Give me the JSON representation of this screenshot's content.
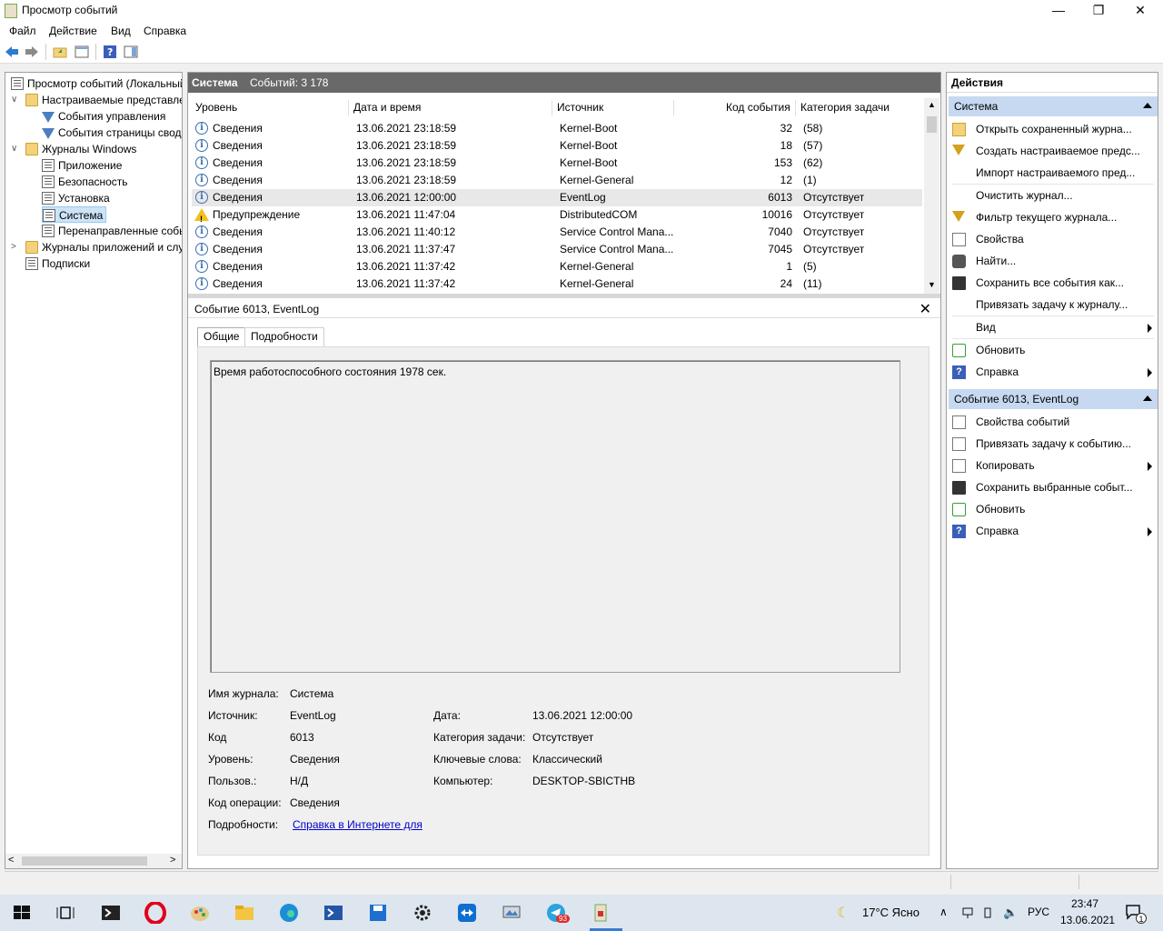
{
  "window": {
    "title": "Просмотр событий",
    "min": "—",
    "max": "❐",
    "close": "✕"
  },
  "menu": [
    "Файл",
    "Действие",
    "Вид",
    "Справка"
  ],
  "tree": [
    {
      "label": "Просмотр событий (Локальный)",
      "level": 0,
      "icon": "event-viewer-icon"
    },
    {
      "label": "Настраиваемые представления",
      "level": 1,
      "icon": "folder-icon",
      "toggle": "∨"
    },
    {
      "label": "События управления",
      "level": 2,
      "icon": "filter-icon"
    },
    {
      "label": "События страницы сводки",
      "level": 2,
      "icon": "filter-icon"
    },
    {
      "label": "Журналы Windows",
      "level": 1,
      "icon": "folder-icon",
      "toggle": "∨"
    },
    {
      "label": "Приложение",
      "level": 2,
      "icon": "log-icon"
    },
    {
      "label": "Безопасность",
      "level": 2,
      "icon": "log-icon"
    },
    {
      "label": "Установка",
      "level": 2,
      "icon": "log-icon"
    },
    {
      "label": "Система",
      "level": 2,
      "icon": "log-icon",
      "selected": true
    },
    {
      "label": "Перенаправленные события",
      "level": 2,
      "icon": "log-icon"
    },
    {
      "label": "Журналы приложений и служб",
      "level": 1,
      "icon": "folder-icon",
      "toggle": ">"
    },
    {
      "label": "Подписки",
      "level": 1,
      "icon": "log-icon"
    }
  ],
  "log": {
    "name": "Система",
    "count": "Событий: 3 178"
  },
  "columns": [
    "Уровень",
    "Дата и время",
    "Источник",
    "Код события",
    "Категория задачи"
  ],
  "events": [
    {
      "level": "Сведения",
      "type": "info",
      "date": "13.06.2021 23:18:59",
      "source": "Kernel-Boot",
      "code": "32",
      "cat": "(58)"
    },
    {
      "level": "Сведения",
      "type": "info",
      "date": "13.06.2021 23:18:59",
      "source": "Kernel-Boot",
      "code": "18",
      "cat": "(57)"
    },
    {
      "level": "Сведения",
      "type": "info",
      "date": "13.06.2021 23:18:59",
      "source": "Kernel-Boot",
      "code": "153",
      "cat": "(62)"
    },
    {
      "level": "Сведения",
      "type": "info",
      "date": "13.06.2021 23:18:59",
      "source": "Kernel-General",
      "code": "12",
      "cat": "(1)"
    },
    {
      "level": "Сведения",
      "type": "info",
      "date": "13.06.2021 12:00:00",
      "source": "EventLog",
      "code": "6013",
      "cat": "Отсутствует",
      "selected": true
    },
    {
      "level": "Предупреждение",
      "type": "warn",
      "date": "13.06.2021 11:47:04",
      "source": "DistributedCOM",
      "code": "10016",
      "cat": "Отсутствует"
    },
    {
      "level": "Сведения",
      "type": "info",
      "date": "13.06.2021 11:40:12",
      "source": "Service Control Mana...",
      "code": "7040",
      "cat": "Отсутствует"
    },
    {
      "level": "Сведения",
      "type": "info",
      "date": "13.06.2021 11:37:47",
      "source": "Service Control Mana...",
      "code": "7045",
      "cat": "Отсутствует"
    },
    {
      "level": "Сведения",
      "type": "info",
      "date": "13.06.2021 11:37:42",
      "source": "Kernel-General",
      "code": "1",
      "cat": "(5)"
    },
    {
      "level": "Сведения",
      "type": "info",
      "date": "13.06.2021 11:37:42",
      "source": "Kernel-General",
      "code": "24",
      "cat": "(11)"
    }
  ],
  "detail": {
    "title": "Событие 6013, EventLog",
    "close": "✕",
    "tabs": [
      "Общие",
      "Подробности"
    ],
    "description": "Время работоспособного состояния 1978 сек.",
    "fields": {
      "log_label": "Имя журнала:",
      "log_value": "Система",
      "source_label": "Источник:",
      "source_value": "EventLog",
      "date_label": "Дата:",
      "date_value": "13.06.2021 12:00:00",
      "code_label": "Код",
      "code_value": "6013",
      "cat_label": "Категория задачи:",
      "cat_value": "Отсутствует",
      "level_label": "Уровень:",
      "level_value": "Сведения",
      "kw_label": "Ключевые слова:",
      "kw_value": "Классический",
      "user_label": "Пользов.:",
      "user_value": "Н/Д",
      "comp_label": "Компьютер:",
      "comp_value": "DESKTOP-SBICTHB",
      "op_label": "Код операции:",
      "op_value": "Сведения",
      "more_label": "Подробности:",
      "more_link": "Справка в Интернете для "
    }
  },
  "actions": {
    "header": "Действия",
    "section1": "Система",
    "items1": [
      {
        "label": "Открыть сохраненный журна...",
        "icon": "open-folder-icon"
      },
      {
        "label": "Создать настраиваемое предс...",
        "icon": "filter-icon"
      },
      {
        "label": "Импорт настраиваемого пред...",
        "icon": ""
      },
      {
        "label": "Очистить журнал...",
        "icon": "",
        "sep": true
      },
      {
        "label": "Фильтр текущего журнала...",
        "icon": "filter-icon"
      },
      {
        "label": "Свойства",
        "icon": "properties-icon"
      },
      {
        "label": "Найти...",
        "icon": "binoculars-icon"
      },
      {
        "label": "Сохранить все события как...",
        "icon": "save-icon"
      },
      {
        "label": "Привязать задачу к журналу...",
        "icon": ""
      },
      {
        "label": "Вид",
        "icon": "",
        "sub": true,
        "sep": true
      },
      {
        "label": "Обновить",
        "icon": "refresh-icon",
        "sep": true
      },
      {
        "label": "Справка",
        "icon": "help-icon",
        "sub": true
      }
    ],
    "section2": "Событие 6013, EventLog",
    "items2": [
      {
        "label": "Свойства событий",
        "icon": "properties-icon"
      },
      {
        "label": "Привязать задачу к событию...",
        "icon": "task-icon"
      },
      {
        "label": "Копировать",
        "icon": "copy-icon",
        "sub": true
      },
      {
        "label": "Сохранить выбранные событ...",
        "icon": "save-icon"
      },
      {
        "label": "Обновить",
        "icon": "refresh-icon"
      },
      {
        "label": "Справка",
        "icon": "help-icon",
        "sub": true
      }
    ]
  },
  "taskbar": {
    "weather": "17°C  Ясно",
    "lang": "РУС",
    "time": "23:47",
    "date": "13.06.2021",
    "badge": "93",
    "notif": "1"
  }
}
